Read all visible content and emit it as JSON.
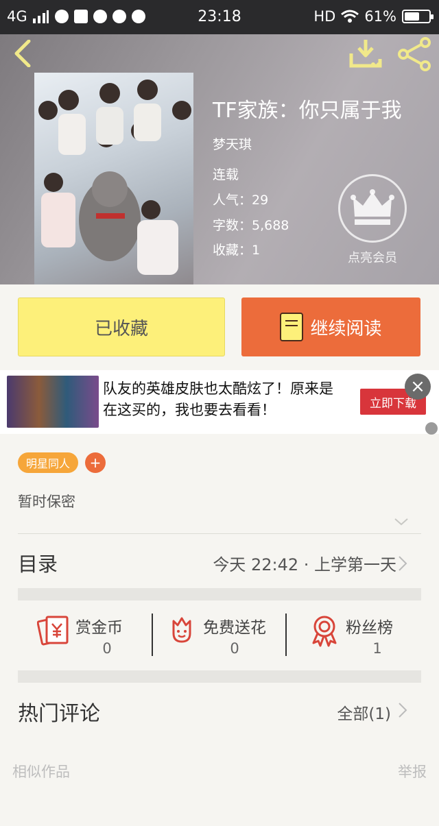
{
  "status_bar": {
    "network": "4G",
    "time": "23:18",
    "hd": "HD",
    "battery": "61%",
    "battery_level": 0.61
  },
  "book": {
    "title": "TF家族：你只属于我",
    "author": "梦天琪",
    "status": "连载",
    "popularity": "人气：29",
    "word_count": "字数：5,688",
    "favorites": "收藏：1"
  },
  "vip": {
    "label": "点亮会员"
  },
  "actions": {
    "collected_label": "已收藏",
    "continue_label": "继续阅读"
  },
  "ad": {
    "text": "队友的英雄皮肤也太酷炫了！原来是在这买的，我也要去看看！",
    "cta": "立即下载"
  },
  "tags": [
    "明星同人"
  ],
  "description": "暂时保密",
  "toc": {
    "label": "目录",
    "latest": "今天 22:42 · 上学第一天"
  },
  "rewards": [
    {
      "label": "赏金币",
      "count": "0"
    },
    {
      "label": "免费送花",
      "count": "0"
    },
    {
      "label": "粉丝榜",
      "count": "1"
    }
  ],
  "comments": {
    "label": "热门评论",
    "all": "全部(1)"
  },
  "footer": {
    "similar": "相似作品",
    "report": "举报"
  },
  "colors": {
    "accent_orange": "#ec6c3b",
    "collected_yellow": "#fdf07a",
    "icon_yellow": "#f1e98a",
    "reward_red": "#d8453a",
    "tag_orange": "#f6a63a"
  }
}
